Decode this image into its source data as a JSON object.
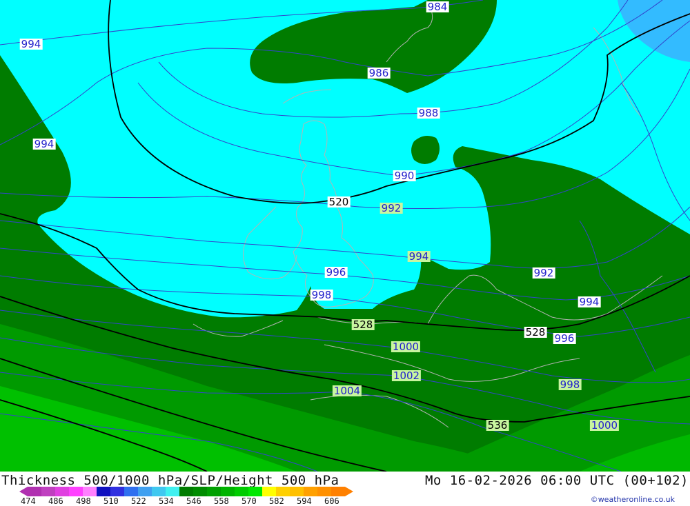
{
  "map": {
    "contour_labels": [
      {
        "text": "984",
        "kind": "slp"
      },
      {
        "text": "986",
        "kind": "slp"
      },
      {
        "text": "988",
        "kind": "slp"
      },
      {
        "text": "990",
        "kind": "slp"
      },
      {
        "text": "992",
        "kind": "slp"
      },
      {
        "text": "994",
        "kind": "slp"
      },
      {
        "text": "994",
        "kind": "slp"
      },
      {
        "text": "994",
        "kind": "slp"
      },
      {
        "text": "996",
        "kind": "slp"
      },
      {
        "text": "998",
        "kind": "slp"
      },
      {
        "text": "992",
        "kind": "slp"
      },
      {
        "text": "994",
        "kind": "slp"
      },
      {
        "text": "996",
        "kind": "slp"
      },
      {
        "text": "998",
        "kind": "slp"
      },
      {
        "text": "1000",
        "kind": "slp"
      },
      {
        "text": "1002",
        "kind": "slp"
      },
      {
        "text": "1004",
        "kind": "slp"
      },
      {
        "text": "1000",
        "kind": "slp"
      },
      {
        "text": "520",
        "kind": "height"
      },
      {
        "text": "528",
        "kind": "height"
      },
      {
        "text": "528",
        "kind": "height"
      },
      {
        "text": "536",
        "kind": "height"
      }
    ],
    "colors": {
      "cyan": "#00ffff",
      "dark_green": "#007c00",
      "mid_green": "#009600",
      "bright_green": "#00c000",
      "deep_blue": "#33aaff",
      "isobar": "#3344cc",
      "height_line": "#000000",
      "coast": "#b0b0b0"
    }
  },
  "footer": {
    "title": "Thickness 500/1000 hPa/SLP/Height 500 hPa",
    "datetime": "Mo 16-02-2026 06:00 UTC (00+102)",
    "credit": "©weatheronline.co.uk",
    "scale_colors": [
      "#b030b0",
      "#c040c0",
      "#e040e0",
      "#ff40ff",
      "#ff80ff",
      "#1010c0",
      "#3030e0",
      "#3070f0",
      "#40a0f0",
      "#40c8f0",
      "#40f0f0",
      "#007c00",
      "#008c00",
      "#00a000",
      "#00b400",
      "#00cc00",
      "#00e800",
      "#ffff00",
      "#ffd000",
      "#ffc000",
      "#ffa000",
      "#ff9000",
      "#ff8000"
    ],
    "scale_ticks": [
      "474",
      "486",
      "498",
      "510",
      "522",
      "534",
      "546",
      "558",
      "570",
      "582",
      "594",
      "606"
    ]
  }
}
